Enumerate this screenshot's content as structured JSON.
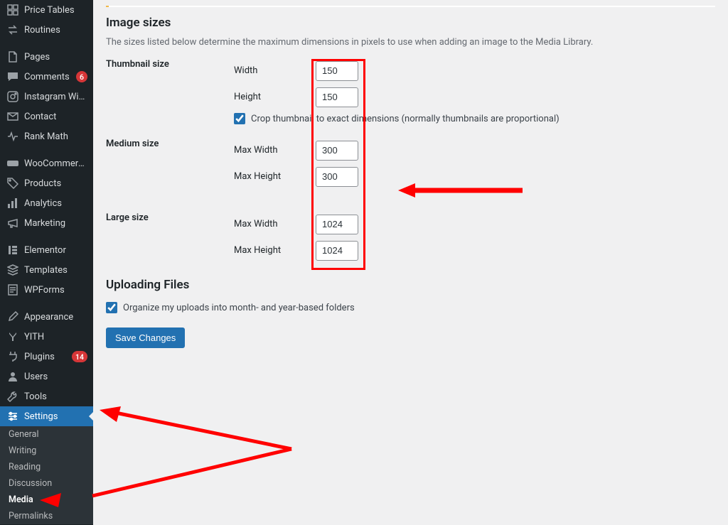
{
  "sidebar": {
    "main": [
      {
        "icon": "grid",
        "label": "Price Tables"
      },
      {
        "icon": "swap",
        "label": "Routines"
      },
      {
        "icon": "page",
        "label": "Pages",
        "sep": true
      },
      {
        "icon": "comment",
        "label": "Comments",
        "badge": "6"
      },
      {
        "icon": "instagram",
        "label": "Instagram Widget"
      },
      {
        "icon": "envelope",
        "label": "Contact"
      },
      {
        "icon": "pulse",
        "label": "Rank Math"
      },
      {
        "icon": "woo",
        "label": "WooCommerce",
        "sep": true
      },
      {
        "icon": "tag",
        "label": "Products"
      },
      {
        "icon": "bars",
        "label": "Analytics"
      },
      {
        "icon": "megaphone",
        "label": "Marketing"
      },
      {
        "icon": "elementor",
        "label": "Elementor",
        "sep": true
      },
      {
        "icon": "stack",
        "label": "Templates"
      },
      {
        "icon": "wpforms",
        "label": "WPForms"
      },
      {
        "icon": "brush",
        "label": "Appearance",
        "sep": true
      },
      {
        "icon": "yith",
        "label": "YITH"
      },
      {
        "icon": "plug",
        "label": "Plugins",
        "badge": "14"
      },
      {
        "icon": "user",
        "label": "Users"
      },
      {
        "icon": "wrench",
        "label": "Tools"
      },
      {
        "icon": "sliders",
        "label": "Settings",
        "selected": true
      }
    ],
    "sub": [
      {
        "label": "General"
      },
      {
        "label": "Writing"
      },
      {
        "label": "Reading"
      },
      {
        "label": "Discussion"
      },
      {
        "label": "Media",
        "active": true
      },
      {
        "label": "Permalinks"
      }
    ]
  },
  "content": {
    "image_sizes_heading": "Image sizes",
    "image_sizes_desc": "The sizes listed below determine the maximum dimensions in pixels to use when adding an image to the Media Library.",
    "thumbnail": {
      "title": "Thumbnail size",
      "width_label": "Width",
      "width_value": "150",
      "height_label": "Height",
      "height_value": "150",
      "crop_label": "Crop thumbnail to exact dimensions (normally thumbnails are proportional)"
    },
    "medium": {
      "title": "Medium size",
      "maxw_label": "Max Width",
      "maxw_value": "300",
      "maxh_label": "Max Height",
      "maxh_value": "300"
    },
    "large": {
      "title": "Large size",
      "maxw_label": "Max Width",
      "maxw_value": "1024",
      "maxh_label": "Max Height",
      "maxh_value": "1024"
    },
    "uploading_heading": "Uploading Files",
    "uploading_organize": "Organize my uploads into month- and year-based folders",
    "save_button": "Save Changes"
  }
}
